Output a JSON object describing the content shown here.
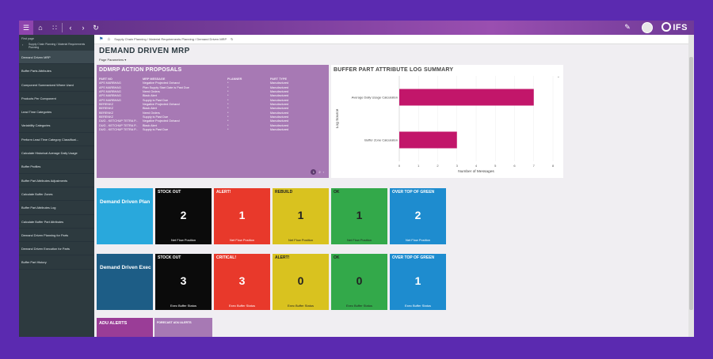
{
  "topbar": {
    "menu_icon": "menu-icon",
    "brand": "IFS"
  },
  "sidebar": {
    "first_page": "First page",
    "path": "Supply Chain Planning / Material Requirements Planning",
    "items": [
      {
        "label": "Demand Driven MRP",
        "active": true
      },
      {
        "label": "Buffer Parts Attributes"
      },
      {
        "label": "Component Summarized Where Used"
      },
      {
        "label": "Products Per Component"
      },
      {
        "label": "Lead Time Categories"
      },
      {
        "label": "Variability Categories"
      },
      {
        "label": "Perform Lead Time Category Classificat..."
      },
      {
        "label": "Calculate Historical Average Daily Usage"
      },
      {
        "label": "Buffer Profiles"
      },
      {
        "label": "Buffer Part Attributes Adjustments"
      },
      {
        "label": "Calculate Buffer Zones"
      },
      {
        "label": "Buffer Part Attributes Log"
      },
      {
        "label": "Calculate Buffer Part Attributes"
      },
      {
        "label": "Demand Driven Planning for Parts"
      },
      {
        "label": "Demand Driven Execution for Parts"
      },
      {
        "label": "Buffer Part History"
      }
    ]
  },
  "breadcrumb": "Supply Chain Planning / Material Requirements Planning / Demand Driven MRP",
  "page": {
    "title": "DEMAND DRIVEN MRP",
    "params": "Page Parameters"
  },
  "ddmrp": {
    "title": "DDMRP ACTION PROPOSALS",
    "headers": [
      "PART NO",
      "MRP MESSAGE",
      "PLANNER",
      "PART TYPE"
    ],
    "rows": [
      [
        "APS MARBHAG",
        "Negative Projected Onhand",
        "*",
        "Manufactured"
      ],
      [
        "APS MARBHAG",
        "Plan Supply Start Date is Past Due",
        "*",
        "Manufactured"
      ],
      [
        "APS MARBHAG",
        "Need Orders",
        "*",
        "Manufactured"
      ],
      [
        "APS MARBHAG",
        "Black Alert",
        "*",
        "Manufactured"
      ],
      [
        "APS MARBHAG",
        "Supply is Past Due",
        "*",
        "Manufactured"
      ],
      [
        "BERENKZ",
        "Negative Projected Onhand",
        "*",
        "Manufactured"
      ],
      [
        "BERENKZ",
        "Black Alert",
        "*",
        "Manufactured"
      ],
      [
        "BERENKZ",
        "Need Orders",
        "*",
        "Manufactured"
      ],
      [
        "BERENKZ",
        "Supply is Past Due",
        "*",
        "Manufactured"
      ],
      [
        "DUG - KETCHUP TETRA P...",
        "Negative Projected Onhand",
        "*",
        "Manufactured"
      ],
      [
        "DUG - KETCHUP TETRA P...",
        "Black Alert",
        "*",
        "Manufactured"
      ],
      [
        "DUG - KETCHUP TETRA P...",
        "Supply is Past Due",
        "*",
        "Manufactured"
      ]
    ],
    "pages": [
      "1",
      "2"
    ]
  },
  "log_chart": {
    "title": "BUFFER PART ATTRIBUTE LOG SUMMARY"
  },
  "chart_data": {
    "type": "bar",
    "orientation": "horizontal",
    "title": "BUFFER PART ATTRIBUTE LOG SUMMARY",
    "categories": [
      "Average Daily Usage Calculation",
      "Buffer Zone Calculation"
    ],
    "values": [
      7,
      3
    ],
    "xlabel": "Number of Messages",
    "ylabel": "Log Source",
    "xlim": [
      0,
      8
    ],
    "xticks": [
      0,
      1,
      2,
      3,
      4,
      5,
      6,
      7,
      8
    ],
    "color": "#c2166a"
  },
  "planning": {
    "title": "Demand Driven Plan",
    "tiles": [
      {
        "title": "STOCK OUT",
        "value": "2",
        "foot": "Net Flow Position",
        "color": "#0b0b0b"
      },
      {
        "title": "ALERT!",
        "value": "1",
        "foot": "Net Flow Position",
        "color": "#e8392b"
      },
      {
        "title": "REBUILD",
        "value": "1",
        "foot": "Net Flow Position",
        "color": "#d9c21f"
      },
      {
        "title": "OK",
        "value": "1",
        "foot": "Net Flow Position",
        "color": "#33a94a"
      },
      {
        "title": "OVER TOP OF GREEN",
        "value": "2",
        "foot": "Net Flow Position",
        "color": "#1e8ccf"
      }
    ]
  },
  "execution": {
    "title": "Demand Driven Exec",
    "tiles": [
      {
        "title": "STOCK OUT",
        "value": "3",
        "foot": "Exec Buffer Status",
        "color": "#0b0b0b"
      },
      {
        "title": "CRITICAL!",
        "value": "3",
        "foot": "Exec Buffer Status",
        "color": "#e8392b"
      },
      {
        "title": "ALERT!",
        "value": "0",
        "foot": "Exec Buffer Status",
        "color": "#d9c21f"
      },
      {
        "title": "OK",
        "value": "0",
        "foot": "Exec Buffer Status",
        "color": "#33a94a"
      },
      {
        "title": "OVER TOP OF GREEN",
        "value": "1",
        "foot": "Exec Buffer Status",
        "color": "#1e8ccf"
      }
    ]
  },
  "adu": {
    "title": "ADU ALERTS",
    "forecast_title": "FORECAST ADU ALERTS"
  }
}
